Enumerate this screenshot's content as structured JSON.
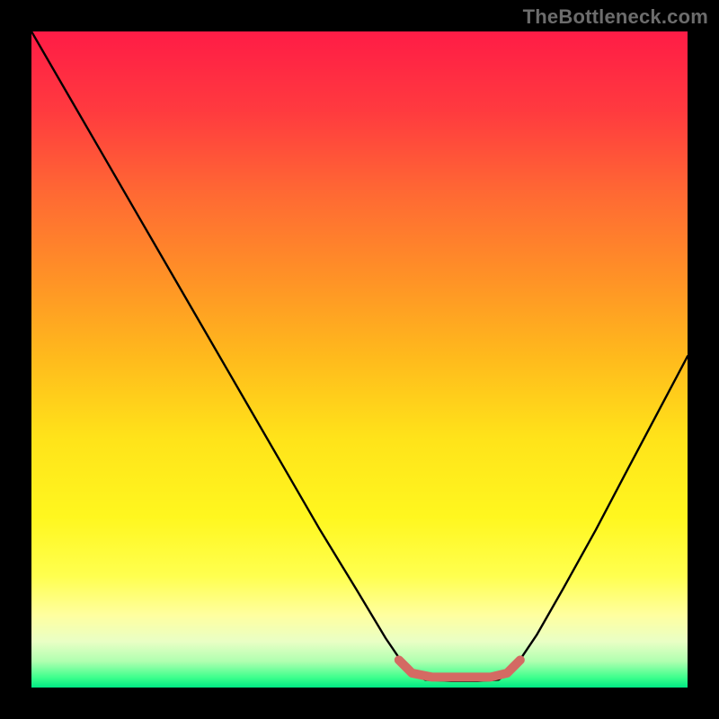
{
  "watermark": "TheBottleneck.com",
  "chart_data": {
    "type": "line",
    "title": "",
    "xlabel": "",
    "ylabel": "",
    "xlim": [
      0,
      1
    ],
    "ylim": [
      0,
      1
    ],
    "grid": false,
    "legend": false,
    "background_gradient_stops": [
      {
        "offset": 0.0,
        "color": "#ff1c46"
      },
      {
        "offset": 0.12,
        "color": "#ff3a3f"
      },
      {
        "offset": 0.25,
        "color": "#ff6a33"
      },
      {
        "offset": 0.38,
        "color": "#ff9326"
      },
      {
        "offset": 0.5,
        "color": "#ffbb1c"
      },
      {
        "offset": 0.62,
        "color": "#ffe31a"
      },
      {
        "offset": 0.74,
        "color": "#fff71f"
      },
      {
        "offset": 0.83,
        "color": "#ffff4f"
      },
      {
        "offset": 0.89,
        "color": "#ffffa0"
      },
      {
        "offset": 0.93,
        "color": "#e9ffc5"
      },
      {
        "offset": 0.96,
        "color": "#b0ffb0"
      },
      {
        "offset": 0.985,
        "color": "#3cff8c"
      },
      {
        "offset": 1.0,
        "color": "#00e884"
      }
    ],
    "series": [
      {
        "name": "bottleneck-curve",
        "color": "#000000",
        "points": [
          {
            "x": 0.0,
            "y": 1.0
          },
          {
            "x": 0.055,
            "y": 0.905
          },
          {
            "x": 0.11,
            "y": 0.81
          },
          {
            "x": 0.165,
            "y": 0.715
          },
          {
            "x": 0.22,
            "y": 0.62
          },
          {
            "x": 0.275,
            "y": 0.525
          },
          {
            "x": 0.33,
            "y": 0.43
          },
          {
            "x": 0.385,
            "y": 0.335
          },
          {
            "x": 0.44,
            "y": 0.24
          },
          {
            "x": 0.495,
            "y": 0.15
          },
          {
            "x": 0.54,
            "y": 0.075
          },
          {
            "x": 0.572,
            "y": 0.028
          },
          {
            "x": 0.6,
            "y": 0.012
          },
          {
            "x": 0.64,
            "y": 0.01
          },
          {
            "x": 0.68,
            "y": 0.01
          },
          {
            "x": 0.712,
            "y": 0.012
          },
          {
            "x": 0.735,
            "y": 0.028
          },
          {
            "x": 0.77,
            "y": 0.08
          },
          {
            "x": 0.81,
            "y": 0.15
          },
          {
            "x": 0.86,
            "y": 0.24
          },
          {
            "x": 0.91,
            "y": 0.335
          },
          {
            "x": 0.955,
            "y": 0.42
          },
          {
            "x": 1.0,
            "y": 0.505
          }
        ]
      },
      {
        "name": "valley-highlight",
        "color": "#d46a63",
        "stroke_width": 10,
        "points": [
          {
            "x": 0.56,
            "y": 0.042
          },
          {
            "x": 0.58,
            "y": 0.022
          },
          {
            "x": 0.61,
            "y": 0.016
          },
          {
            "x": 0.655,
            "y": 0.016
          },
          {
            "x": 0.7,
            "y": 0.016
          },
          {
            "x": 0.725,
            "y": 0.022
          },
          {
            "x": 0.745,
            "y": 0.042
          }
        ]
      }
    ]
  }
}
